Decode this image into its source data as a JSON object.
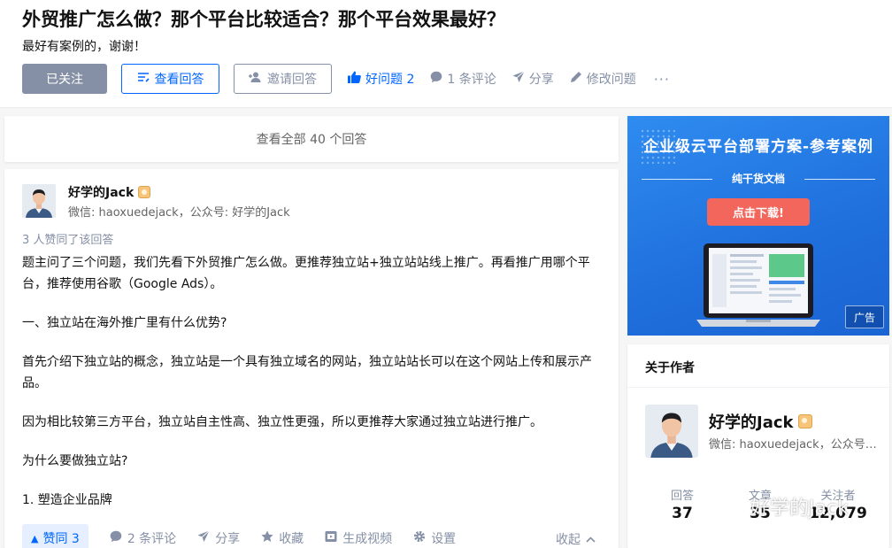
{
  "question": {
    "title": "外贸推广怎么做？那个平台比较适合？那个平台效果最好？",
    "detail": "最好有案例的，谢谢！",
    "actions": {
      "followed": "已关注",
      "view_answers": "查看回答",
      "invite": "邀请回答",
      "good_question": "好问题 2",
      "comments": "1 条评论",
      "share": "分享",
      "edit": "修改问题",
      "more": "···"
    }
  },
  "view_all": "查看全部 40 个回答",
  "answer": {
    "author_name": "好学的Jack",
    "author_bio": "微信: haoxuedejack，公众号: 好学的Jack",
    "voters": "3 人赞同了该回答",
    "paragraphs": [
      "题主问了三个问题，我们先看下外贸推广怎么做。更推荐独立站+独立站站线上推广。再看推广用哪个平台，推荐使用谷歌（Google Ads）。",
      "一、独立站在海外推广里有什么优势?",
      "首先介绍下独立站的概念，独立站是一个具有独立域名的网站，独立站站长可以在这个网站上传和展示产品。",
      "因为相比较第三方平台，独立站自主性高、独立性更强，所以更推荐大家通过独立站进行推广。",
      "为什么要做独立站?",
      "1. 塑造企业品牌"
    ],
    "actions": {
      "vote": "赞同 3",
      "comments": "2 条评论",
      "share": "分享",
      "favorite": "收藏",
      "video": "生成视频",
      "settings": "设置",
      "collapse": "收起"
    }
  },
  "ad": {
    "title": "企业级云平台部署方案-参考案例",
    "subtitle": "纯干货文档",
    "button": "点击下载!",
    "tag": "广告"
  },
  "about": {
    "heading": "关于作者",
    "name": "好学的Jack",
    "bio": "微信: haoxuedejack，公众号: 好学的Jack",
    "stats": [
      {
        "label": "回答",
        "value": "37"
      },
      {
        "label": "文章",
        "value": "35"
      },
      {
        "label": "关注者",
        "value": "12,079"
      }
    ]
  },
  "watermark": "好学的Jack",
  "colors": {
    "primary": "#0066ff",
    "muted": "#8590a6",
    "followed_bg": "#8590a6",
    "ad_bg": "#1f6fdc",
    "ad_button": "#f2665c"
  }
}
